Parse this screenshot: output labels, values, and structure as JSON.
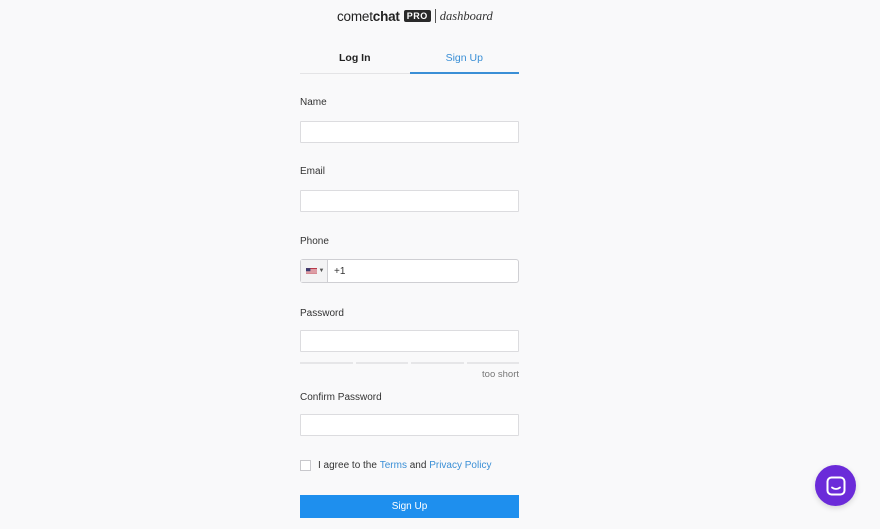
{
  "logo": {
    "comet": "comet",
    "chat": "chat",
    "badge": "PRO",
    "product": "dashboard"
  },
  "tabs": [
    {
      "label": "Log In",
      "active": false
    },
    {
      "label": "Sign Up",
      "active": true
    }
  ],
  "form": {
    "name_label": "Name",
    "name_value": "",
    "email_label": "Email",
    "email_value": "",
    "phone_label": "Phone",
    "phone_value": "+1",
    "phone_country": "us-flag-icon",
    "password_label": "Password",
    "password_value": "",
    "password_strength": "too short",
    "password_strength_level": 0,
    "confirm_label": "Confirm Password",
    "confirm_value": "",
    "terms": {
      "prefix": "I agree to the",
      "terms_link": "Terms",
      "and": "and",
      "policy_link": "Privacy Policy",
      "checked": false
    },
    "submit_label": "Sign Up"
  },
  "colors": {
    "accent": "#3a8fd6",
    "button": "#1e8fee",
    "chat_bubble": "#6b2bd9",
    "background": "#f9f9fa"
  },
  "chat_widget": {
    "icon": "chat-icon"
  }
}
